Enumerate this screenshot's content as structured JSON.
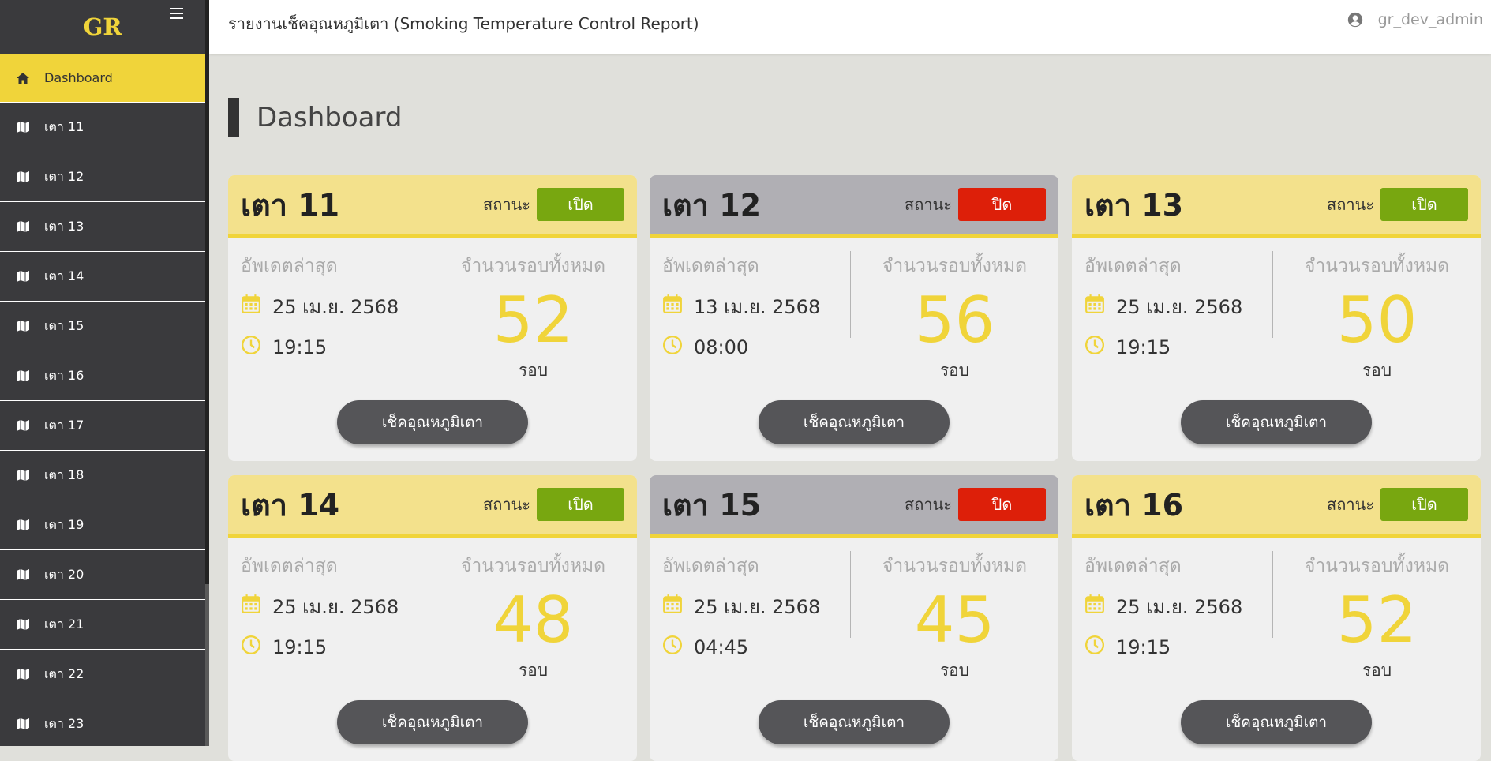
{
  "app": {
    "brand": "GR",
    "header_title": "รายงานเช็คอุณหภูมิเตา (Smoking Temperature Control Report)",
    "username": "gr_dev_admin"
  },
  "sidebar": {
    "items": [
      {
        "label": "Dashboard",
        "icon": "home-icon",
        "active": true
      },
      {
        "label": "เตา 11",
        "icon": "map-icon"
      },
      {
        "label": "เตา 12",
        "icon": "map-icon"
      },
      {
        "label": "เตา 13",
        "icon": "map-icon"
      },
      {
        "label": "เตา 14",
        "icon": "map-icon"
      },
      {
        "label": "เตา 15",
        "icon": "map-icon"
      },
      {
        "label": "เตา 16",
        "icon": "map-icon"
      },
      {
        "label": "เตา 17",
        "icon": "map-icon"
      },
      {
        "label": "เตา 18",
        "icon": "map-icon"
      },
      {
        "label": "เตา 19",
        "icon": "map-icon"
      },
      {
        "label": "เตา 20",
        "icon": "map-icon"
      },
      {
        "label": "เตา 21",
        "icon": "map-icon"
      },
      {
        "label": "เตา 22",
        "icon": "map-icon"
      },
      {
        "label": "เตา 23",
        "icon": "map-icon"
      }
    ]
  },
  "page": {
    "title": "Dashboard"
  },
  "labels": {
    "status": "สถานะ",
    "last_update": "อัพเดตล่าสุด",
    "total_rounds": "จำนวนรอบทั้งหมด",
    "unit": "รอบ",
    "check_button": "เช็คอุณหภูมิเตา"
  },
  "colors": {
    "accent": "#f0d43a",
    "sidebar_bg": "#3a3a3d",
    "status_on": "#78a710",
    "status_off": "#dd1f09"
  },
  "ovens": [
    {
      "name": "เตา 11",
      "status": "เปิด",
      "on": true,
      "date": "25 เม.ย. 2568",
      "time": "19:15",
      "rounds": "52"
    },
    {
      "name": "เตา 12",
      "status": "ปิด",
      "on": false,
      "date": "13 เม.ย. 2568",
      "time": "08:00",
      "rounds": "56"
    },
    {
      "name": "เตา 13",
      "status": "เปิด",
      "on": true,
      "date": "25 เม.ย. 2568",
      "time": "19:15",
      "rounds": "50"
    },
    {
      "name": "เตา 14",
      "status": "เปิด",
      "on": true,
      "date": "25 เม.ย. 2568",
      "time": "19:15",
      "rounds": "48"
    },
    {
      "name": "เตา 15",
      "status": "ปิด",
      "on": false,
      "date": "25 เม.ย. 2568",
      "time": "04:45",
      "rounds": "45"
    },
    {
      "name": "เตา 16",
      "status": "เปิด",
      "on": true,
      "date": "25 เม.ย. 2568",
      "time": "19:15",
      "rounds": "52"
    }
  ]
}
